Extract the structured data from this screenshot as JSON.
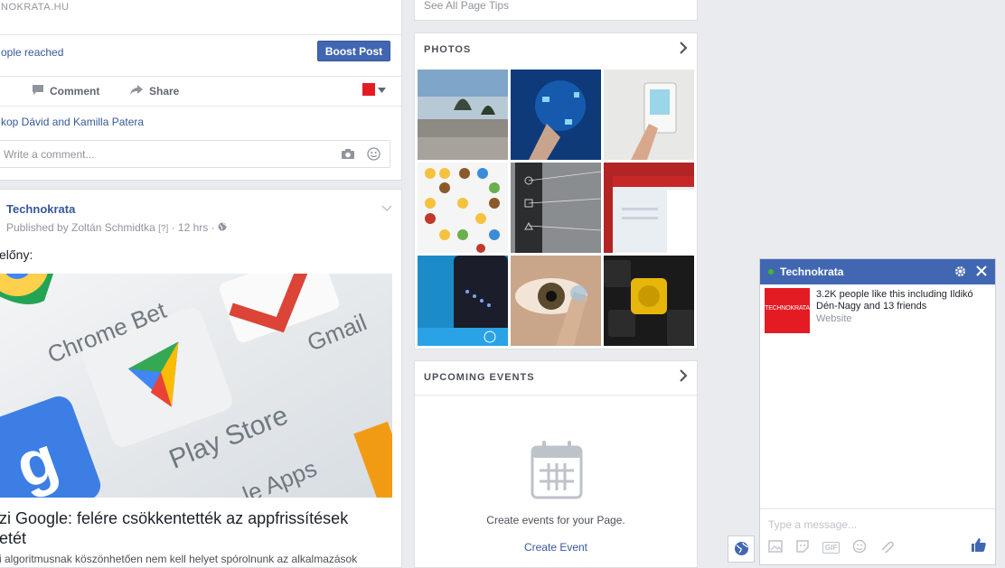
{
  "top_post": {
    "link_domain": "NOKRATA.HU",
    "reach_text": "ople reached",
    "boost_label": "Boost Post",
    "comment_label": "Comment",
    "share_label": "Share",
    "likers_text": "kop Dávid and Kamilla Patera",
    "comment_placeholder": "Write a comment..."
  },
  "post": {
    "page_name": "Technokrata",
    "published_by": "Published by Zoltán Schmidtka",
    "help_mark": "[?]",
    "time": "12 hrs",
    "body_fragment": "előny:",
    "link_title_line1": "zi Google: felére csökkentették az appfrissítések",
    "link_title_line2": "etét",
    "link_desc": "i algoritmusnak köszönhetően nem kell helyet spórolnunk az alkalmazások",
    "image_labels": {
      "chrome": "Chrome Bet",
      "gmail": "Gmail",
      "play_store": "Play Store",
      "apps": "le Apps"
    }
  },
  "sidebar": {
    "tips_link": "See All Page Tips",
    "photos_title": "PHOTOS",
    "events_title": "UPCOMING EVENTS",
    "events_empty_text": "Create events for your Page.",
    "create_event_label": "Create Event"
  },
  "chat": {
    "title": "Technokrata",
    "logo_text": "TECHNOKRATA",
    "likes_text": "3.2K people like this including Ildikó Dén-Nagy and 13 friends",
    "category": "Website",
    "input_placeholder": "Type a message...",
    "gif_label": "GIF"
  },
  "colors": {
    "facebook_blue": "#4267b2",
    "link_blue": "#365899",
    "online_green": "#42b72a",
    "brand_red": "#e41b23"
  }
}
